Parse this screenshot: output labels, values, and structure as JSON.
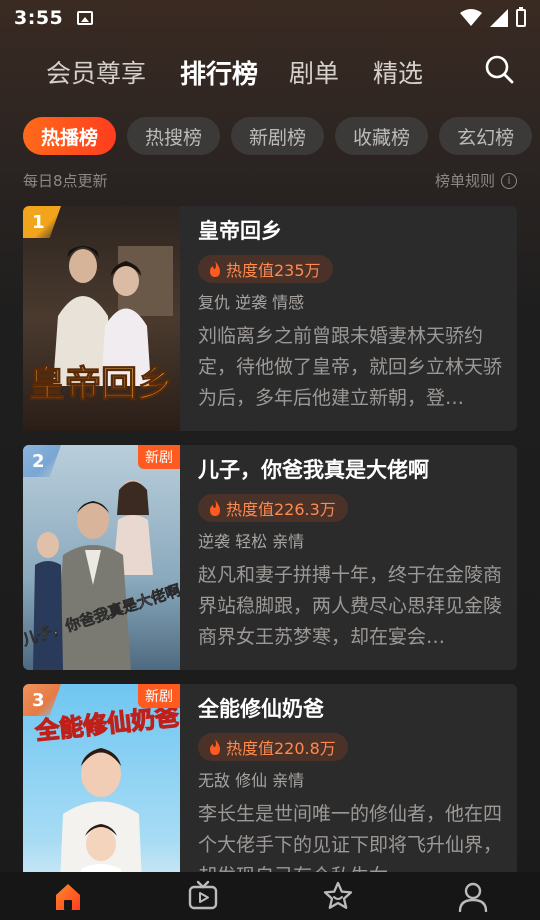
{
  "status": {
    "time": "3:55"
  },
  "nav": {
    "tabs": [
      {
        "label": "会员尊享"
      },
      {
        "label": "排行榜"
      },
      {
        "label": "剧单"
      },
      {
        "label": "精选"
      }
    ],
    "active_tab": "排行榜"
  },
  "chips": [
    {
      "label": "热播榜"
    },
    {
      "label": "热搜榜"
    },
    {
      "label": "新剧榜"
    },
    {
      "label": "收藏榜"
    },
    {
      "label": "玄幻榜"
    }
  ],
  "update_note": "每日8点更新",
  "rules_label": "榜单规则",
  "dramas": [
    {
      "rank": "1",
      "is_new": false,
      "poster_text": "皇帝回乡",
      "title": "皇帝回乡",
      "heat": "热度值235万",
      "tags": "复仇  逆袭  情感",
      "desc": "刘临离乡之前曾跟未婚妻林天骄约定，待他做了皇帝，就回乡立林天骄为后，多年后他建立新朝，登…"
    },
    {
      "rank": "2",
      "is_new": true,
      "new_label": "新剧",
      "poster_text": "儿子，你爸我真是大佬啊",
      "title": "儿子，你爸我真是大佬啊",
      "heat": "热度值226.3万",
      "tags": "逆袭  轻松  亲情",
      "desc": "赵凡和妻子拼搏十年，终于在金陵商界站稳脚跟，两人费尽心思拜见金陵商界女王苏梦寒，却在宴会…"
    },
    {
      "rank": "3",
      "is_new": true,
      "new_label": "新剧",
      "poster_text": "全能修仙奶爸",
      "title": "全能修仙奶爸",
      "heat": "热度值220.8万",
      "tags": "无敌  修仙  亲情",
      "desc": "李长生是世间唯一的修仙者，他在四个大佬手下的见证下即将飞升仙界，却发现自己有个私生女…"
    }
  ],
  "bottom_nav": [
    {
      "icon": "home-icon",
      "active": true
    },
    {
      "icon": "tv-icon",
      "active": false
    },
    {
      "icon": "star-icon",
      "active": false
    },
    {
      "icon": "profile-icon",
      "active": false
    }
  ],
  "colors": {
    "accent": "#ff5a1f",
    "chip_active": "#ff4a1f",
    "heat_text": "#ff8a50"
  }
}
